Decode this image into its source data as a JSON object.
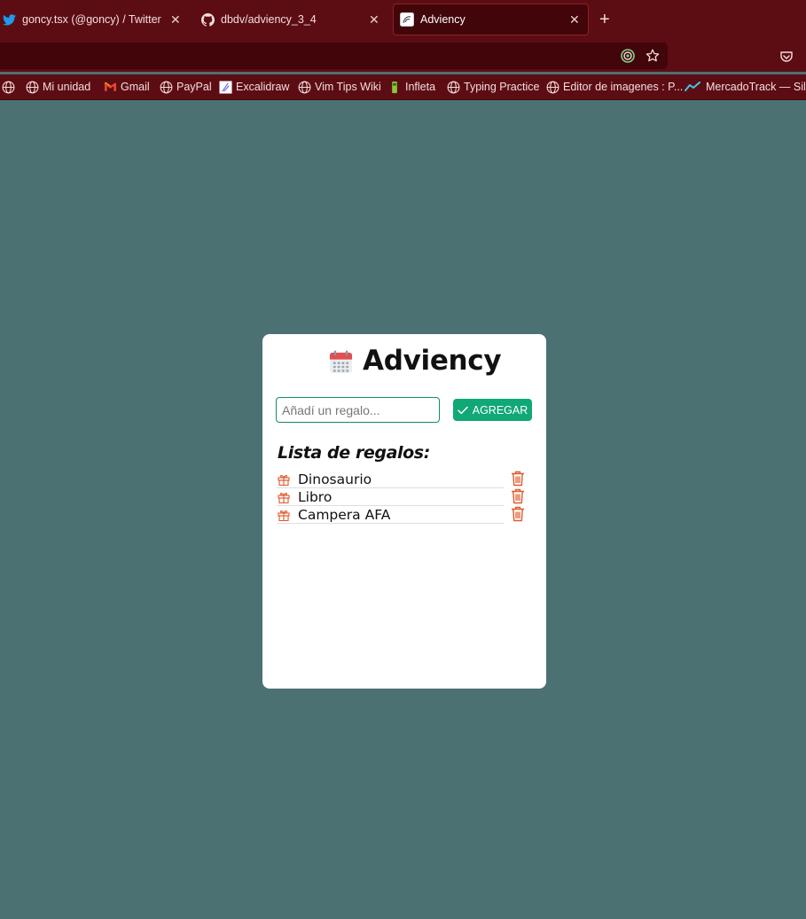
{
  "browser": {
    "tabs": [
      {
        "label": "goncy.tsx (@goncy) / Twitter",
        "icon": "twitter-icon",
        "active": false
      },
      {
        "label": "dbdv/adviency_3_4",
        "icon": "github-icon",
        "active": false
      },
      {
        "label": "Adviency",
        "icon": "page-icon",
        "active": true
      }
    ],
    "new_tab": "+",
    "close_glyph": "✕",
    "bookmarks": [
      {
        "label": "",
        "icon": "globe-icon"
      },
      {
        "label": "Mi unidad",
        "icon": "globe-icon"
      },
      {
        "label": "Gmail",
        "icon": "gmail-icon"
      },
      {
        "label": "PayPal",
        "icon": "globe-icon"
      },
      {
        "label": "Excalidraw",
        "icon": "excalidraw-icon"
      },
      {
        "label": "Vim Tips Wiki",
        "icon": "globe-icon"
      },
      {
        "label": "Infleta",
        "icon": "infleta-icon"
      },
      {
        "label": "Typing Practice",
        "icon": "globe-icon"
      },
      {
        "label": "Editor de imagenes : P...",
        "icon": "globe-icon"
      },
      {
        "label": "MercadoTrack — Silla",
        "icon": "mercadotrack-icon"
      }
    ]
  },
  "app": {
    "title": "Adviency",
    "title_icon": "calendar-icon",
    "input_placeholder": "Añadí un regalo...",
    "input_value": "",
    "add_label": "AGREGAR",
    "list_heading": "Lista de regalos:",
    "gifts": [
      {
        "name": "Dinosaurio"
      },
      {
        "name": "Libro"
      },
      {
        "name": "Campera AFA"
      }
    ]
  },
  "colors": {
    "background": "#4c7172",
    "chrome": "#5c0d13",
    "accent": "#10a876",
    "delete": "#e05a2b"
  }
}
